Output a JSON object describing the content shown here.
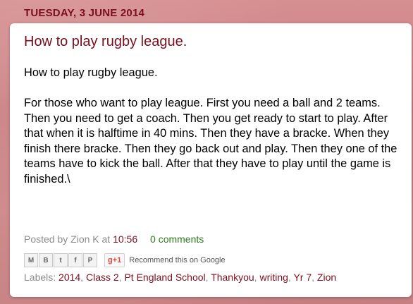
{
  "date_header": "TUESDAY, 3 JUNE 2014",
  "post": {
    "title": "How to play rugby league.",
    "body_intro": "How to play rugby league.",
    "body_text": "For those who want to play league. First you need a ball and 2 teams. Then you need to get a coach. Then you get ready to start to play. After that when it is halftime in 40 mins. Then  they have a bracke. When they  finish there bracke. Then they go back out and play. Then they one of the teams have to kick the ball. After that they have to play until the game is finished.\\"
  },
  "footer": {
    "posted_by": "Posted by Zion K at",
    "time": "10:56",
    "comments": "0 comments"
  },
  "share": {
    "buttons": [
      {
        "name": "email-share-icon",
        "glyph": "M"
      },
      {
        "name": "blogger-share-icon",
        "glyph": "B"
      },
      {
        "name": "twitter-share-icon",
        "glyph": "t"
      },
      {
        "name": "facebook-share-icon",
        "glyph": "f"
      },
      {
        "name": "pinterest-share-icon",
        "glyph": "P"
      }
    ],
    "gplus_label": "g+1",
    "recommend": "Recommend this on Google"
  },
  "labels": {
    "prefix": "Labels:",
    "items": [
      "2014",
      "Class 2",
      "Pt England School",
      "Thankyou",
      "writing",
      "Yr 7",
      "Zion"
    ]
  }
}
